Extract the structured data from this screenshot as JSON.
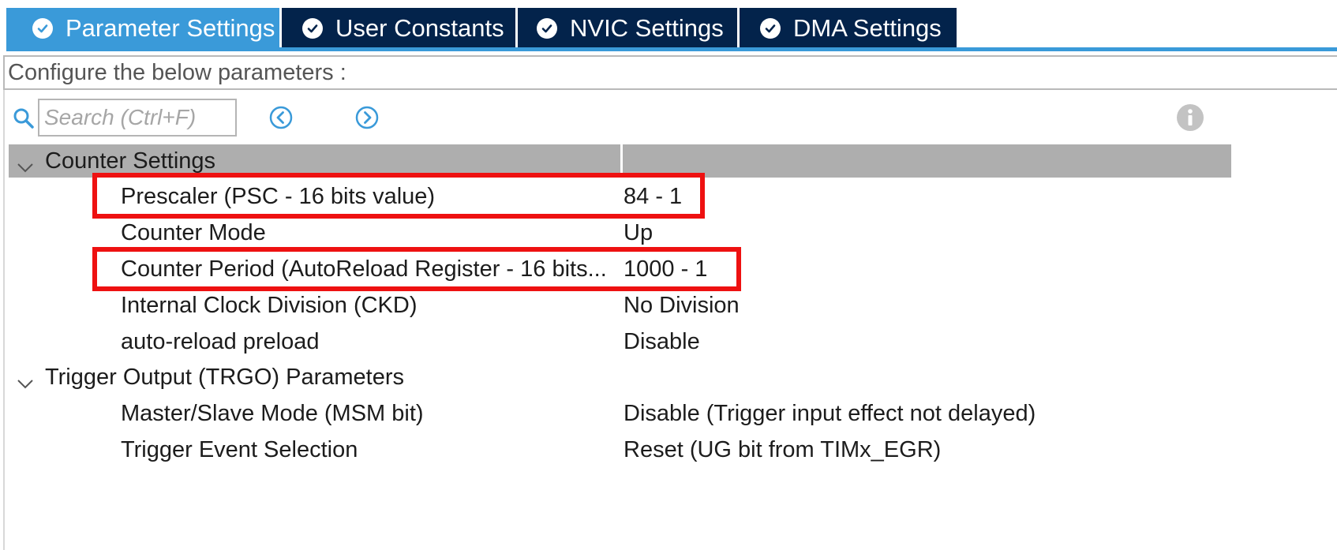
{
  "tabs": [
    {
      "label": "Parameter Settings",
      "active": true
    },
    {
      "label": "User Constants",
      "active": false
    },
    {
      "label": "NVIC Settings",
      "active": false
    },
    {
      "label": "DMA Settings",
      "active": false
    }
  ],
  "colors": {
    "tab_active": "#3a9ad9",
    "tab_inactive": "#03234b",
    "section_header": "#aeaeae",
    "highlight": "#ee1111",
    "icon_blue": "#3a9ad9"
  },
  "configure_label": "Configure the below parameters :",
  "search": {
    "placeholder": "Search (Ctrl+F)",
    "value": ""
  },
  "icons": {
    "search": "search-icon",
    "previous": "chevron-left-circle-icon",
    "next": "chevron-right-circle-icon",
    "info": "info-icon",
    "tab_check": "check-circle-icon",
    "expand": "chevron-down-icon"
  },
  "sections": [
    {
      "label": "Counter Settings",
      "expanded": true,
      "params": [
        {
          "name": "Prescaler (PSC - 16 bits value)",
          "value": "84 - 1",
          "highlighted": true
        },
        {
          "name": "Counter Mode",
          "value": "Up",
          "highlighted": false
        },
        {
          "name": "Counter Period (AutoReload Register - 16 bits...",
          "value": "1000 - 1",
          "highlighted": true
        },
        {
          "name": "Internal Clock Division (CKD)",
          "value": "No Division",
          "highlighted": false
        },
        {
          "name": "auto-reload preload",
          "value": "Disable",
          "highlighted": false
        }
      ]
    },
    {
      "label": "Trigger Output (TRGO) Parameters",
      "expanded": true,
      "params": [
        {
          "name": "Master/Slave Mode (MSM bit)",
          "value": "Disable (Trigger input effect not delayed)",
          "highlighted": false
        },
        {
          "name": "Trigger Event Selection",
          "value": "Reset (UG bit from TIMx_EGR)",
          "highlighted": false
        }
      ]
    }
  ]
}
